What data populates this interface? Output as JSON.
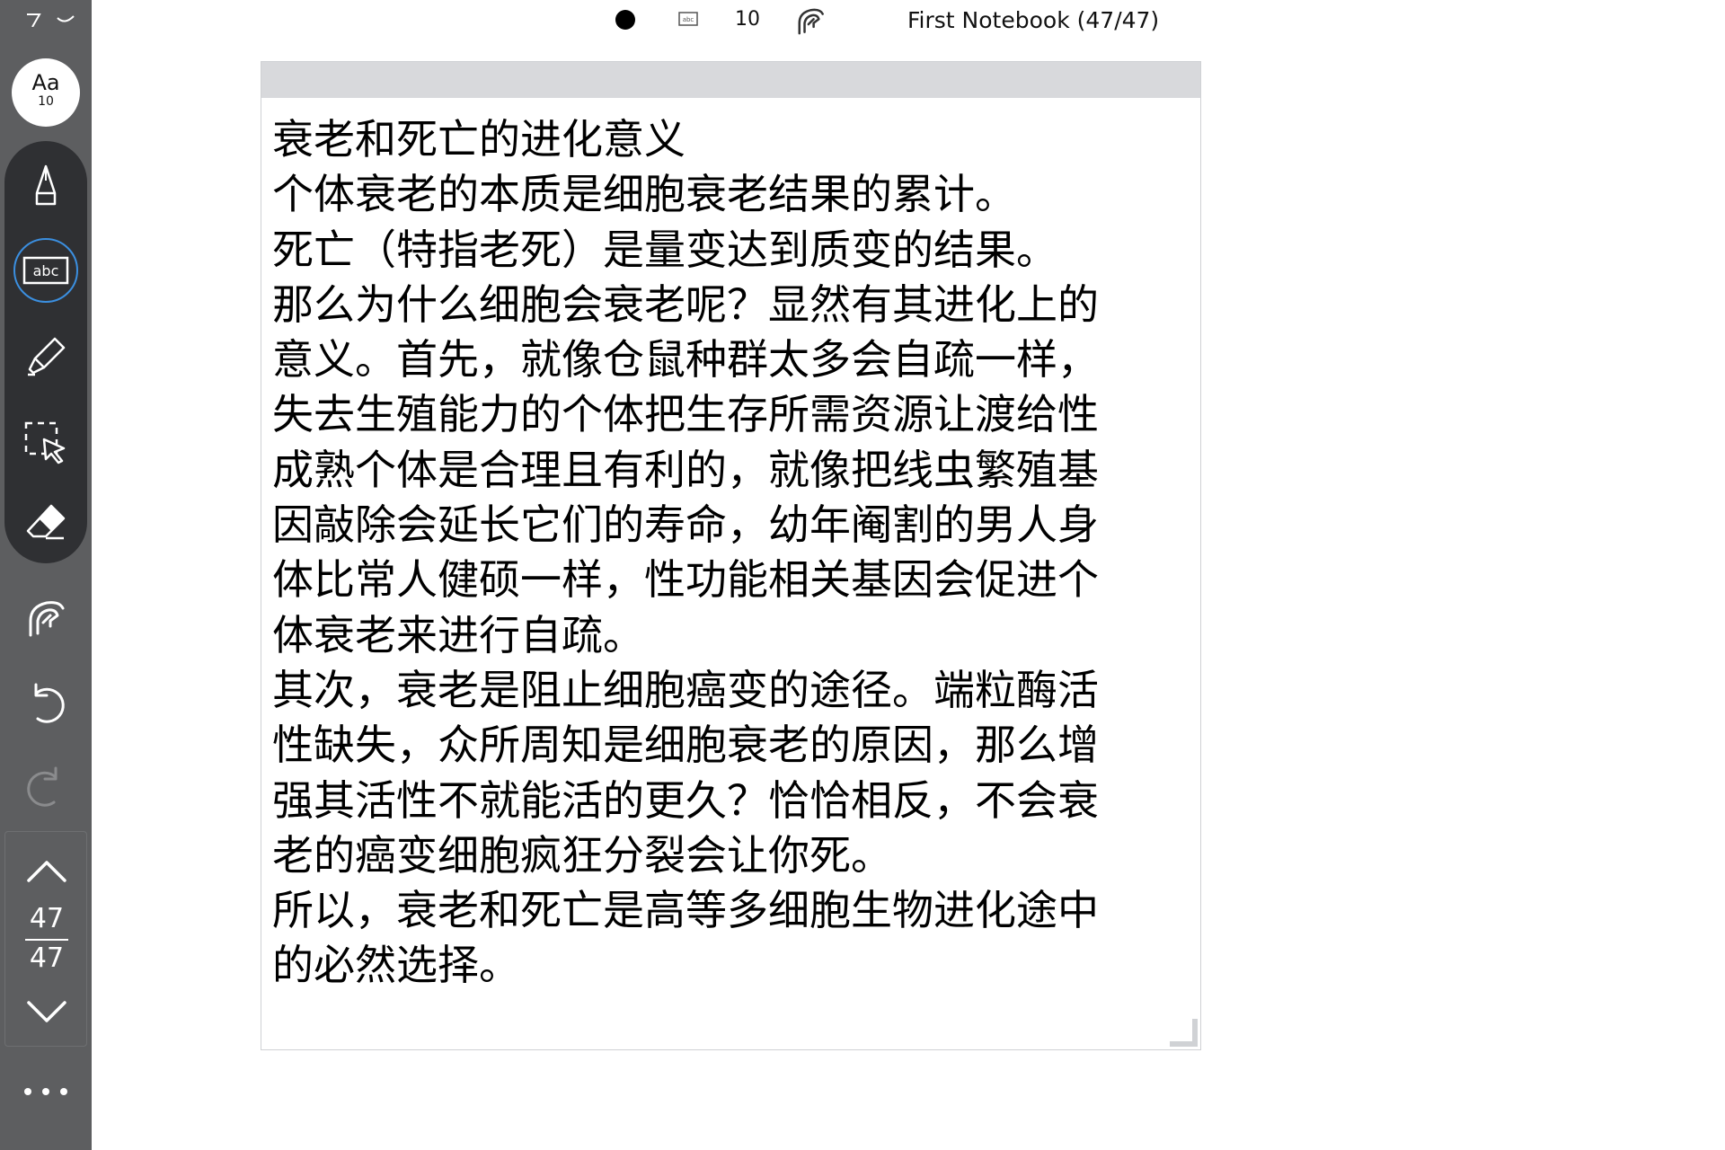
{
  "toolbar": {
    "color": "#000000",
    "font_size": "10",
    "notebook_title": "First Notebook (47/47)"
  },
  "sidebar": {
    "font_button": {
      "label": "Aa",
      "size": "10"
    },
    "tools": [
      {
        "name": "pen",
        "icon": "pen-icon"
      },
      {
        "name": "text",
        "icon": "text-abc-icon",
        "label": "abc",
        "active": true
      },
      {
        "name": "highlighter",
        "icon": "highlighter-icon"
      },
      {
        "name": "lasso-select",
        "icon": "lasso-select-icon"
      },
      {
        "name": "eraser",
        "icon": "eraser-icon"
      }
    ],
    "hand_tool": "hand-touch-icon",
    "undo": "undo-icon",
    "redo": "redo-icon",
    "page_nav": {
      "current": "47",
      "total": "47"
    },
    "more": "more-icon"
  },
  "text_box": {
    "lines": [
      "衰老和死亡的进化意义",
      "个体衰老的本质是细胞衰老结果的累计。",
      "死亡（特指老死）是量变达到质变的结果。",
      "那么为什么细胞会衰老呢？显然有其进化上的",
      "意义。首先，就像仓鼠种群太多会自疏一样，",
      "失去生殖能力的个体把生存所需资源让渡给性",
      "成熟个体是合理且有利的，就像把线虫繁殖基",
      "因敲除会延长它们的寿命，幼年阉割的男人身",
      "体比常人健硕一样，性功能相关基因会促进个",
      "体衰老来进行自疏。",
      "其次，衰老是阻止细胞癌变的途径。端粒酶活",
      "性缺失，众所周知是细胞衰老的原因，那么增",
      "强其活性不就能活的更久？恰恰相反，不会衰",
      "老的癌变细胞疯狂分裂会让你死。",
      "所以，衰老和死亡是高等多细胞生物进化途中",
      "的必然选择。"
    ]
  }
}
